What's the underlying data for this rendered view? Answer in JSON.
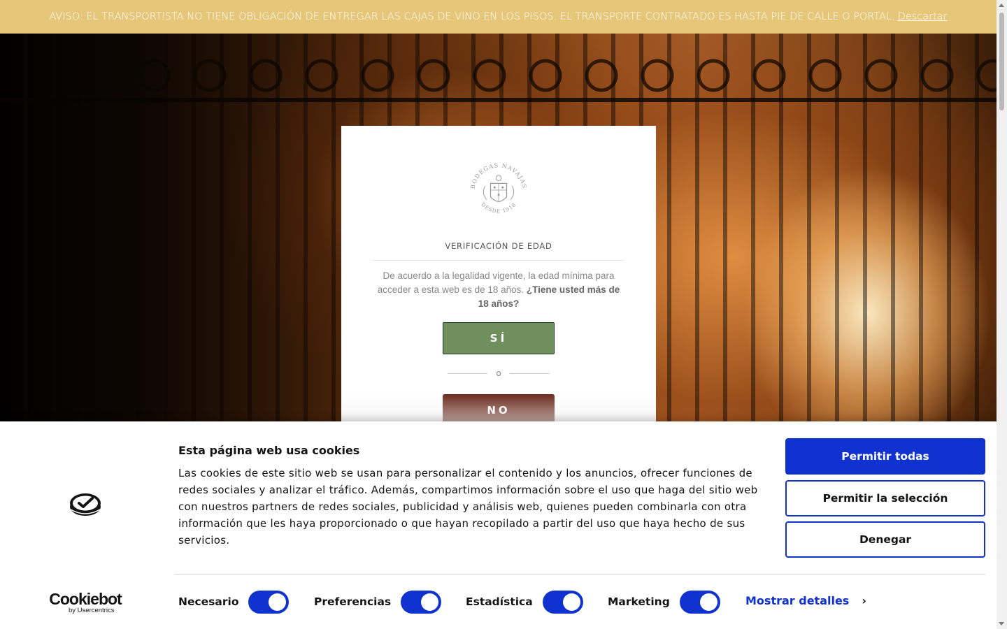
{
  "notice": {
    "text": "AVISO: EL TRANSPORTISTA NO TIENE OBLIGACIÓN DE ENTREGAR LAS CAJAS DE VINO EN LOS PISOS. EL TRANSPORTE CONTRATADO ES HASTA PIE DE CALLE O PORTAL.",
    "dismiss_label": "Descartar"
  },
  "age_modal": {
    "logo_top_text": "BODEGAS NAVAJAS",
    "logo_bottom_text": "DESDE 1918",
    "title": "VERIFICACIÓN DE EDAD",
    "text_plain": "De acuerdo a la legalidad vigente, la edad mínima para acceder a esta web es de 18 años.",
    "text_bold": "¿Tiene usted más de 18 años?",
    "yes_label": "SÍ",
    "or_label": "o",
    "no_label": "NO"
  },
  "cookie_banner": {
    "title": "Esta página web usa cookies",
    "text": "Las cookies de este sitio web se usan para personalizar el contenido y los anuncios, ofrecer funciones de redes sociales y analizar el tráfico. Además, compartimos información sobre el uso que haga del sitio web con nuestros partners de redes sociales, publicidad y análisis web, quienes pueden combinarla con otra información que les haya proporcionado o que hayan recopilado a partir del uso que haya hecho de sus servicios.",
    "allow_all_label": "Permitir todas",
    "allow_selection_label": "Permitir la selección",
    "deny_label": "Denegar",
    "brand_name": "Cookiebot",
    "brand_sub": "by Usercentrics",
    "toggles": [
      {
        "label": "Necesario",
        "checked": true
      },
      {
        "label": "Preferencias",
        "checked": true
      },
      {
        "label": "Estadística",
        "checked": true
      },
      {
        "label": "Marketing",
        "checked": true
      }
    ],
    "show_details_label": "Mostrar detalles",
    "accent_color": "#1032cf"
  },
  "colors": {
    "notice_bg": "#e6c678",
    "yes_button": "#6f8f5c",
    "no_button": "#6b2a1d"
  }
}
